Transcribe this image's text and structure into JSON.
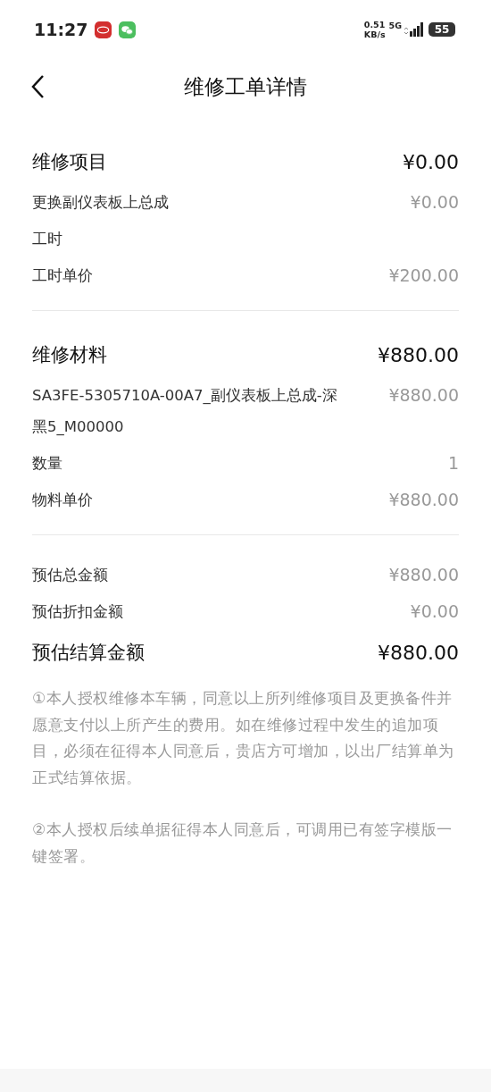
{
  "status_bar": {
    "time": "11:27",
    "speed_value": "0.51",
    "speed_unit": "KB/s",
    "network": "5G",
    "battery": "55"
  },
  "header": {
    "title": "维修工单详情"
  },
  "items": [
    {
      "kind": "heading",
      "label": "维修项目",
      "value": "¥0.00"
    },
    {
      "kind": "row",
      "label": "更换副仪表板上总成",
      "value": "¥0.00"
    },
    {
      "kind": "row",
      "label": "工时"
    },
    {
      "kind": "row",
      "label": "工时单价",
      "value": "¥200.00"
    },
    {
      "kind": "divider"
    },
    {
      "kind": "heading",
      "label": "维修材料",
      "value": "¥880.00"
    },
    {
      "kind": "row",
      "label": "SA3FE-5305710A-00A7_副仪表板上总成-深黑5_M00000",
      "value": "¥880.00"
    },
    {
      "kind": "row",
      "label": "数量",
      "value": "1"
    },
    {
      "kind": "row",
      "label": "物料单价",
      "value": "¥880.00"
    },
    {
      "kind": "divider"
    },
    {
      "kind": "row",
      "label": "预估总金额",
      "value": "¥880.00"
    },
    {
      "kind": "row",
      "label": "预估折扣金额",
      "value": "¥0.00"
    },
    {
      "kind": "heading",
      "label": "预估结算金额",
      "value": "¥880.00"
    }
  ],
  "notes": [
    "①本人授权维修本车辆，同意以上所列维修项目及更换备件并愿意支付以上所产生的费用。如在维修过程中发生的追加项目，必须在征得本人同意后，贵店方可增加，以出厂结算单为正式结算依据。",
    "②本人授权后续单据征得本人同意后，可调用已有签字模版一键签署。"
  ]
}
